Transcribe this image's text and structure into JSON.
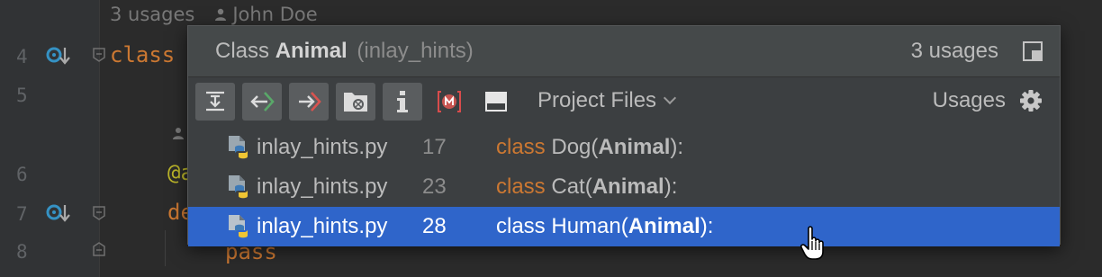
{
  "editor": {
    "inlay": {
      "usages": "3 usages",
      "author": "John Doe"
    },
    "line_numbers": [
      "4",
      "5",
      "6",
      "7",
      "8"
    ],
    "code": {
      "class_kw": "class",
      "decorator": "@a",
      "def_kw": "de",
      "pass_kw": "pass"
    }
  },
  "popup": {
    "title_prefix": "Class",
    "title_name": "Animal",
    "title_module": "(inlay_hints)",
    "usage_count": "3 usages",
    "scope_label": "Project Files",
    "usages_label": "Usages",
    "toolbar_icons": [
      "expand-all-icon",
      "previous-occurrence-icon",
      "next-occurrence-icon",
      "open-in-find-window-icon",
      "info-icon",
      "module-filter-icon",
      "preview-icon"
    ],
    "results": [
      {
        "file": "inlay_hints.py",
        "line": "17",
        "kw": "class",
        "pre": " Dog(",
        "bold": "Animal",
        "post": "):"
      },
      {
        "file": "inlay_hints.py",
        "line": "23",
        "kw": "class",
        "pre": " Cat(",
        "bold": "Animal",
        "post": "):"
      },
      {
        "file": "inlay_hints.py",
        "line": "28",
        "kw": "class",
        "pre": " Human(",
        "bold": "Animal",
        "post": "):"
      }
    ],
    "selected_index": 2
  },
  "colors": {
    "background": "#2b2b2b",
    "popup": "#3c3f41",
    "selection": "#2f65ca",
    "keyword": "#cc7832"
  }
}
